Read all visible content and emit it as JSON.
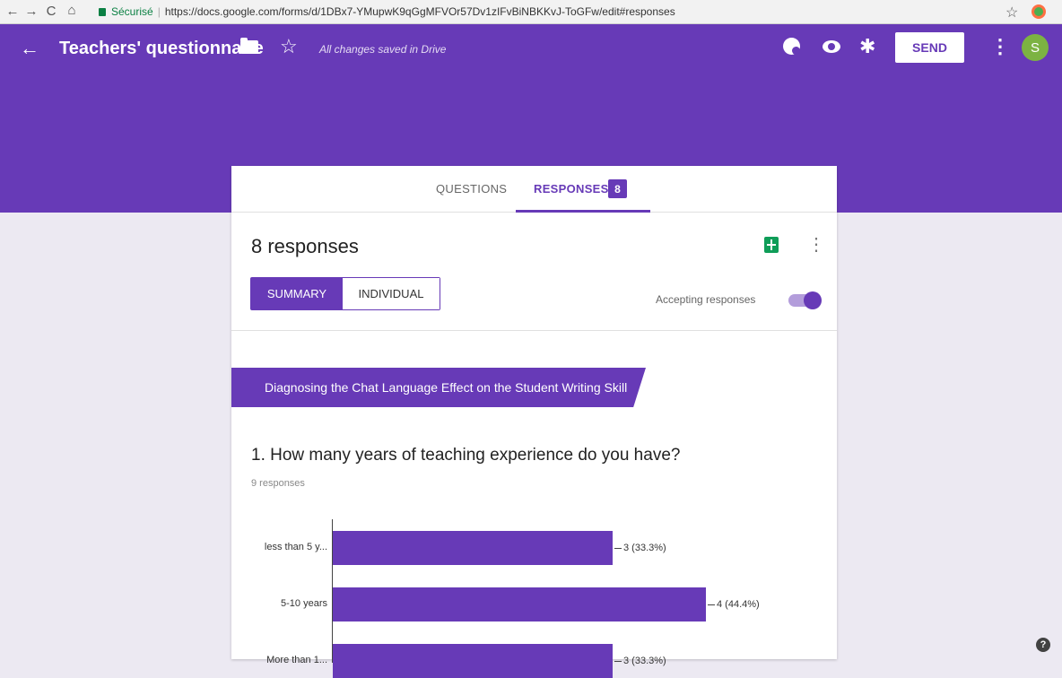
{
  "browser": {
    "back": "←",
    "forward": "→",
    "reload": "C",
    "home": "⌂",
    "secure_label": "Sécurisé",
    "separator": "|",
    "url": "https://docs.google.com/forms/d/1DBx7-YMupwK9qGgMFVOr57Dv1zIFvBiNBKKvJ-ToGFw/edit#responses"
  },
  "header": {
    "title": "Teachers' questionnaire",
    "saved_status": "All changes saved in Drive",
    "send_label": "SEND",
    "avatar_letter": "S",
    "accent_color": "#673ab7"
  },
  "tabs": {
    "questions_label": "QUESTIONS",
    "responses_label": "RESPONSES",
    "responses_badge": "8"
  },
  "summary": {
    "response_count": "8 responses",
    "summary_label": "SUMMARY",
    "individual_label": "INDIVIDUAL",
    "accepting_label": "Accepting responses",
    "accepting": true
  },
  "section": {
    "title": "Diagnosing the Chat Language Effect on the Student Writing Skill"
  },
  "question": {
    "title": "1. How many years of teaching experience do you have?",
    "response_count": "9 responses"
  },
  "chart_data": {
    "type": "bar",
    "orientation": "horizontal",
    "categories": [
      "less than 5 y...",
      "5-10 years",
      "More than 1..."
    ],
    "values": [
      3,
      4,
      3
    ],
    "labels": [
      "3 (33.3%)",
      "4 (44.4%)",
      "3 (33.3%)"
    ],
    "xlim": [
      0,
      4.5
    ]
  },
  "help": "?"
}
